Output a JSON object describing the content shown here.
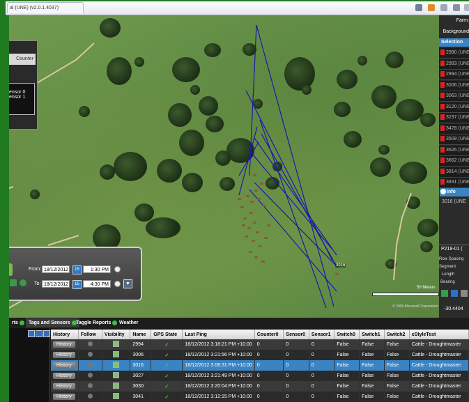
{
  "window": {
    "tab_title": "al (UNE) (v2.0.1.4037)"
  },
  "left_panel": {
    "header": "Counter",
    "lines": [
      "ensor 0",
      "ensor 1"
    ]
  },
  "time_panel": {
    "from_label": "From:",
    "from_date": "18/12/2012",
    "from_time": "1:30 PM",
    "to_label": "To:",
    "to_date": "18/12/2012",
    "to_time": "4:30 PM",
    "cal_label": "15"
  },
  "map": {
    "cow_label": "3016",
    "scale_label": "50 Meters",
    "copyright": "© 2009 Microsoft Corporation"
  },
  "sidebar": {
    "farm_label": "Farm:",
    "backgrounds_label": "Background",
    "selection_label": "Selection",
    "items": [
      "2990 (UNE",
      "2993 (UNE",
      "2994 (UNE",
      "3006 (UNE",
      "3063 (UNE",
      "3120 (UNE",
      "3237 (UNE",
      "3478 (UNE",
      "3508 (UNE",
      "3626 (UNE",
      "3662 (UNE",
      "3814 (UNE",
      "3831 (UNE"
    ],
    "info_label": "Info",
    "info_item": "3016 (UNE",
    "paddock": "P219-01 (",
    "row_spacing": "Row Spacing",
    "segment": "Segment",
    "length": "Length",
    "bearing": "Bearing",
    "coord": "-30.4404"
  },
  "tabs": [
    "rts",
    "Tags and Sensors",
    "Taggle Reports",
    "Weather"
  ],
  "grid": {
    "columns": [
      "History",
      "Follow",
      "Visibility",
      "Name",
      "GPS State",
      "Last Ping",
      "Counter0",
      "Sensor0",
      "Sensor1",
      "Switch0",
      "Switch1",
      "Switch2",
      "cStyleTest"
    ],
    "history_label": "History",
    "gps_ok": "✓",
    "rows": [
      {
        "name": "2994",
        "ping": "18/12/2012 3:18:21 PM +10:00",
        "counter0": "0",
        "sensor0": "0",
        "sensor1": "0",
        "switch0": "False",
        "switch1": "False",
        "switch2": "False",
        "style": "Cattle - Droughtmaster"
      },
      {
        "name": "3006",
        "ping": "18/12/2012 3:21:56 PM +10:00",
        "counter0": "0",
        "sensor0": "0",
        "sensor1": "0",
        "switch0": "False",
        "switch1": "False",
        "switch2": "False",
        "style": "Cattle - Droughtmaster"
      },
      {
        "name": "3016",
        "ping": "18/12/2012 3:08:31 PM +10:00",
        "counter0": "0",
        "sensor0": "0",
        "sensor1": "0",
        "switch0": "False",
        "switch1": "False",
        "switch2": "False",
        "style": "Cattle - Droughtmaster"
      },
      {
        "name": "3027",
        "ping": "18/12/2012 3:21:49 PM +10:00",
        "counter0": "0",
        "sensor0": "0",
        "sensor1": "0",
        "switch0": "False",
        "switch1": "False",
        "switch2": "False",
        "style": "Cattle - Droughtmaster"
      },
      {
        "name": "3030",
        "ping": "18/12/2012 3:20:04 PM +10:00",
        "counter0": "0",
        "sensor0": "0",
        "sensor1": "0",
        "switch0": "False",
        "switch1": "False",
        "switch2": "False",
        "style": "Cattle - Droughtmaster"
      },
      {
        "name": "3041",
        "ping": "18/12/2012 3:12:15 PM +10:00",
        "counter0": "0",
        "sensor0": "0",
        "sensor1": "0",
        "switch0": "False",
        "switch1": "False",
        "switch2": "False",
        "style": "Cattle - Droughtmaster"
      }
    ],
    "selected_row": 2
  },
  "colors": {
    "track": "#1a1aa8",
    "selection": "#3b84c4",
    "tag_flag": "#dd2222",
    "frame": "#1f7a1f"
  }
}
